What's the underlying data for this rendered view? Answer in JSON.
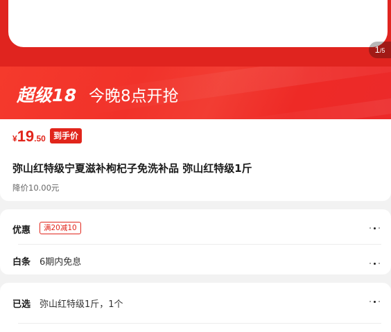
{
  "gallery": {
    "pager_current": "1",
    "pager_total": "/5"
  },
  "promo": {
    "brand": "超级18",
    "time_text": "今晚8点开抢"
  },
  "price": {
    "currency": "¥",
    "integer": "19",
    "decimal": ".50",
    "final_tag": "到手价"
  },
  "product": {
    "title": "弥山红特级宁夏滋补枸杞子免洗补品 弥山红特级1斤",
    "price_drop": "降价10.00元"
  },
  "offers": {
    "discount_label": "优惠",
    "coupon_text": "满20减10",
    "baitiao_label": "白条",
    "baitiao_text": "6期内免息"
  },
  "selection": {
    "label": "已选",
    "value": "弥山红特级1斤，1个"
  },
  "colors": {
    "accent_red": "#e1251b",
    "banner_red": "#f23a2f"
  },
  "icons": {
    "more": "more-dots-icon"
  }
}
